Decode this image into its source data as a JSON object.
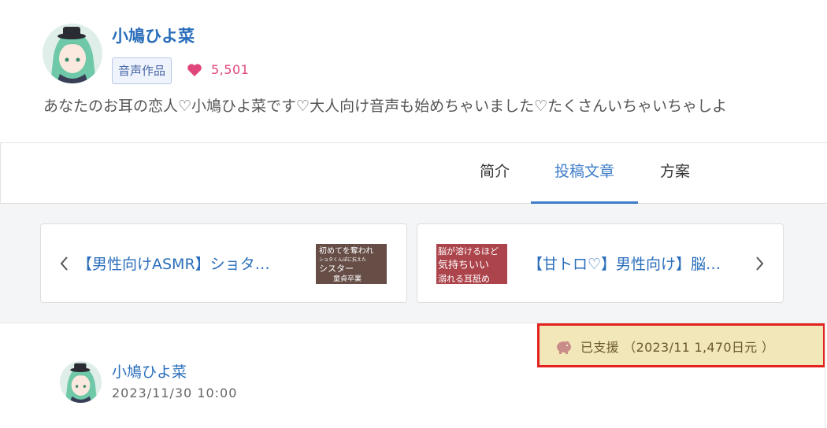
{
  "creator": {
    "name": "小鳩ひよ菜",
    "category": "音声作品",
    "fan_count": "5,501",
    "description": "あなたのお耳の恋人♡小鳩ひよ菜です♡大人向け音声も始めちゃいました♡たくさんいちゃいちゃしよ"
  },
  "tabs": [
    {
      "label": "简介",
      "active": false
    },
    {
      "label": "投稿文章",
      "active": true
    },
    {
      "label": "方案",
      "active": false
    }
  ],
  "nav": {
    "prev_title": "【男性向けASMR】ショタ…",
    "prev_thumb_text": [
      "初めてを奪われ",
      "ショタくんぽに抗えた",
      "シスター",
      "童貞卒業"
    ],
    "next_title": "【甘トロ♡】男性向け】脳…",
    "next_thumb_text": [
      "脳が溶けるほど",
      "気持ちいい",
      "溺れる耳舐め"
    ]
  },
  "support": {
    "label": "已支援 （2023/11 1,470日元 ）"
  },
  "post": {
    "author": "小鳩ひよ菜",
    "date": "2023/11/30 10:00"
  },
  "colors": {
    "accent": "#3d7cc9",
    "link": "#2a6ebb",
    "heart": "#e0457b",
    "support_bg": "#f2e7b8",
    "highlight_border": "#e3221f"
  },
  "icons": {
    "heart": "heart-icon",
    "prev": "chevron-left-icon",
    "next": "chevron-right-icon",
    "support": "piggy-bank-icon"
  }
}
